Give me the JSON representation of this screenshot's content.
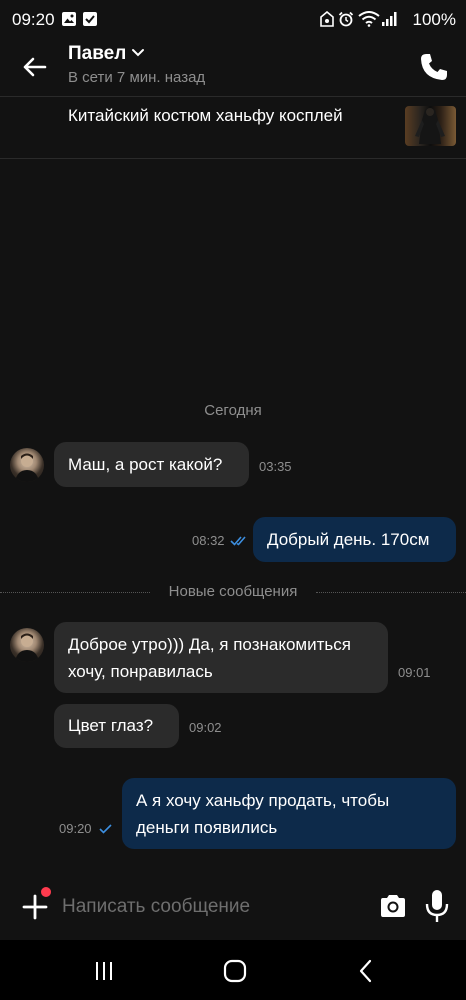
{
  "status_bar": {
    "time": "09:20",
    "battery": "100%"
  },
  "header": {
    "contact_name": "Павел",
    "contact_status": "В сети 7 мин. назад"
  },
  "product": {
    "title": "Китайский костюм ханьфу косплей"
  },
  "chat": {
    "date_separator": "Сегодня",
    "new_messages_separator": "Новые сообщения",
    "messages": [
      {
        "direction": "in",
        "text": "Маш, а рост какой?",
        "time": "03:35"
      },
      {
        "direction": "out",
        "text": "Добрый день. 170см",
        "time": "08:32",
        "status": "read"
      },
      {
        "direction": "in",
        "text": "Доброе утро))) Да, я познакомиться хочу, понравилась",
        "time": "09:01"
      },
      {
        "direction": "in",
        "text": "Цвет глаз?",
        "time": "09:02"
      },
      {
        "direction": "out",
        "text": "А я хочу ханьфу продать, чтобы деньги появились",
        "time": "09:20",
        "status": "delivered"
      }
    ]
  },
  "input": {
    "placeholder": "Написать сообщение"
  },
  "colors": {
    "background": "#121212",
    "incoming_bubble": "#2b2b2b",
    "outgoing_bubble": "#0d2a4a",
    "check_mark": "#3d8fe0",
    "notification_dot": "#ff3b4e"
  }
}
